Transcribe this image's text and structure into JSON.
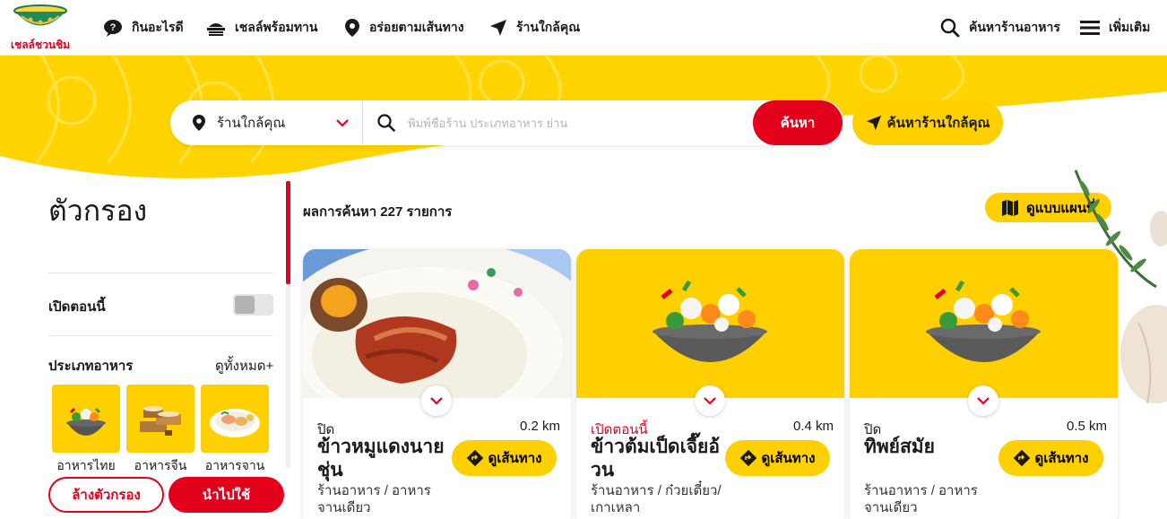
{
  "brand": {
    "logo_text": "เชลล์ชวนชิม"
  },
  "nav": {
    "items": [
      {
        "label": "กินอะไรดี",
        "icon": "question-bubble-icon"
      },
      {
        "label": "เชลล์พร้อมทาน",
        "icon": "food-tray-icon"
      },
      {
        "label": "อร่อยตามเส้นทาง",
        "icon": "map-pin-icon"
      },
      {
        "label": "ร้านใกล้คุณ",
        "icon": "navigation-arrow-icon"
      }
    ],
    "search_label": "ค้นหาร้านอาหาร",
    "more_label": "เพิ่มเติม"
  },
  "search": {
    "location_value": "ร้านใกล้คุณ",
    "placeholder": "พิมพ์ชื่อร้าน ประเภทอาหาร ย่าน",
    "button_label": "ค้นหา",
    "nearby_label": "ค้นหาร้านใกล้คุณ"
  },
  "filter": {
    "title": "ตัวกรอง",
    "open_now_label": "เปิดตอนนี้",
    "open_now_enabled": false,
    "food_type_label": "ประเภทอาหาร",
    "see_all_label": "ดูทั้งหมด+",
    "categories": [
      {
        "label": "อาหารไทย"
      },
      {
        "label": "อาหารจีน"
      },
      {
        "label": "อาหารจาน"
      }
    ],
    "clear_label": "ล้างตัวกรอง",
    "apply_label": "นำไปใช้"
  },
  "results": {
    "header": "ผลการค้นหา 227 รายการ",
    "map_label": "ดูแบบแผนที่",
    "cards": [
      {
        "status": "ปิด",
        "distance": "0.2 km",
        "name": "ข้าวหมูแดงนายชุ่น",
        "type": "ร้านอาหาร / อาหารจานเดียว",
        "direction_label": "ดูเส้นทาง"
      },
      {
        "status": "เปิดตอนนี้",
        "distance": "0.4 km",
        "name": "ข้าวต้มเป็ดเจี๊ยอ้วน",
        "type": "ร้านอาหาร / ก๋วยเตี๋ยว/เกาเหลา",
        "direction_label": "ดูเส้นทาง"
      },
      {
        "status": "ปิด",
        "distance": "0.5 km",
        "name": "ทิพย์สมัย",
        "type": "ร้านอาหาร / อาหารจานเดียว",
        "direction_label": "ดูเส้นทาง"
      }
    ]
  },
  "colors": {
    "brand_red": "#e3001b",
    "brand_yellow": "#ffd000",
    "text_dark": "#1a1a1a"
  }
}
